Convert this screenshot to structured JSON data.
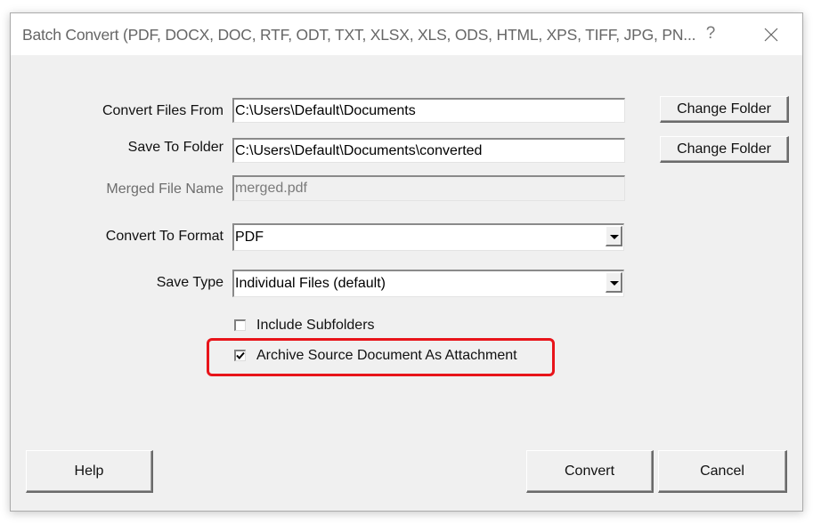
{
  "window": {
    "title": "Batch Convert (PDF, DOCX, DOC, RTF, ODT, TXT, XLSX, XLS, ODS, HTML, XPS, TIFF, JPG, PN...",
    "help_glyph": "?",
    "close_icon": "close-icon"
  },
  "form": {
    "convert_from": {
      "label": "Convert Files From",
      "value": "C:\\Users\\Default\\Documents",
      "button": "Change Folder"
    },
    "save_to": {
      "label": "Save To Folder",
      "value": "C:\\Users\\Default\\Documents\\converted",
      "button": "Change Folder"
    },
    "merged_name": {
      "label": "Merged File Name",
      "value": "merged.pdf",
      "disabled": true
    },
    "format": {
      "label": "Convert To Format",
      "selected": "PDF"
    },
    "save_type": {
      "label": "Save Type",
      "selected": "Individual Files (default)"
    },
    "include_subfolders": {
      "label": "Include Subfolders",
      "checked": false
    },
    "archive_source": {
      "label": "Archive Source Document As Attachment",
      "checked": true,
      "highlighted": true,
      "highlight_color": "#e8141a"
    }
  },
  "footer": {
    "help": "Help",
    "convert": "Convert",
    "cancel": "Cancel"
  }
}
